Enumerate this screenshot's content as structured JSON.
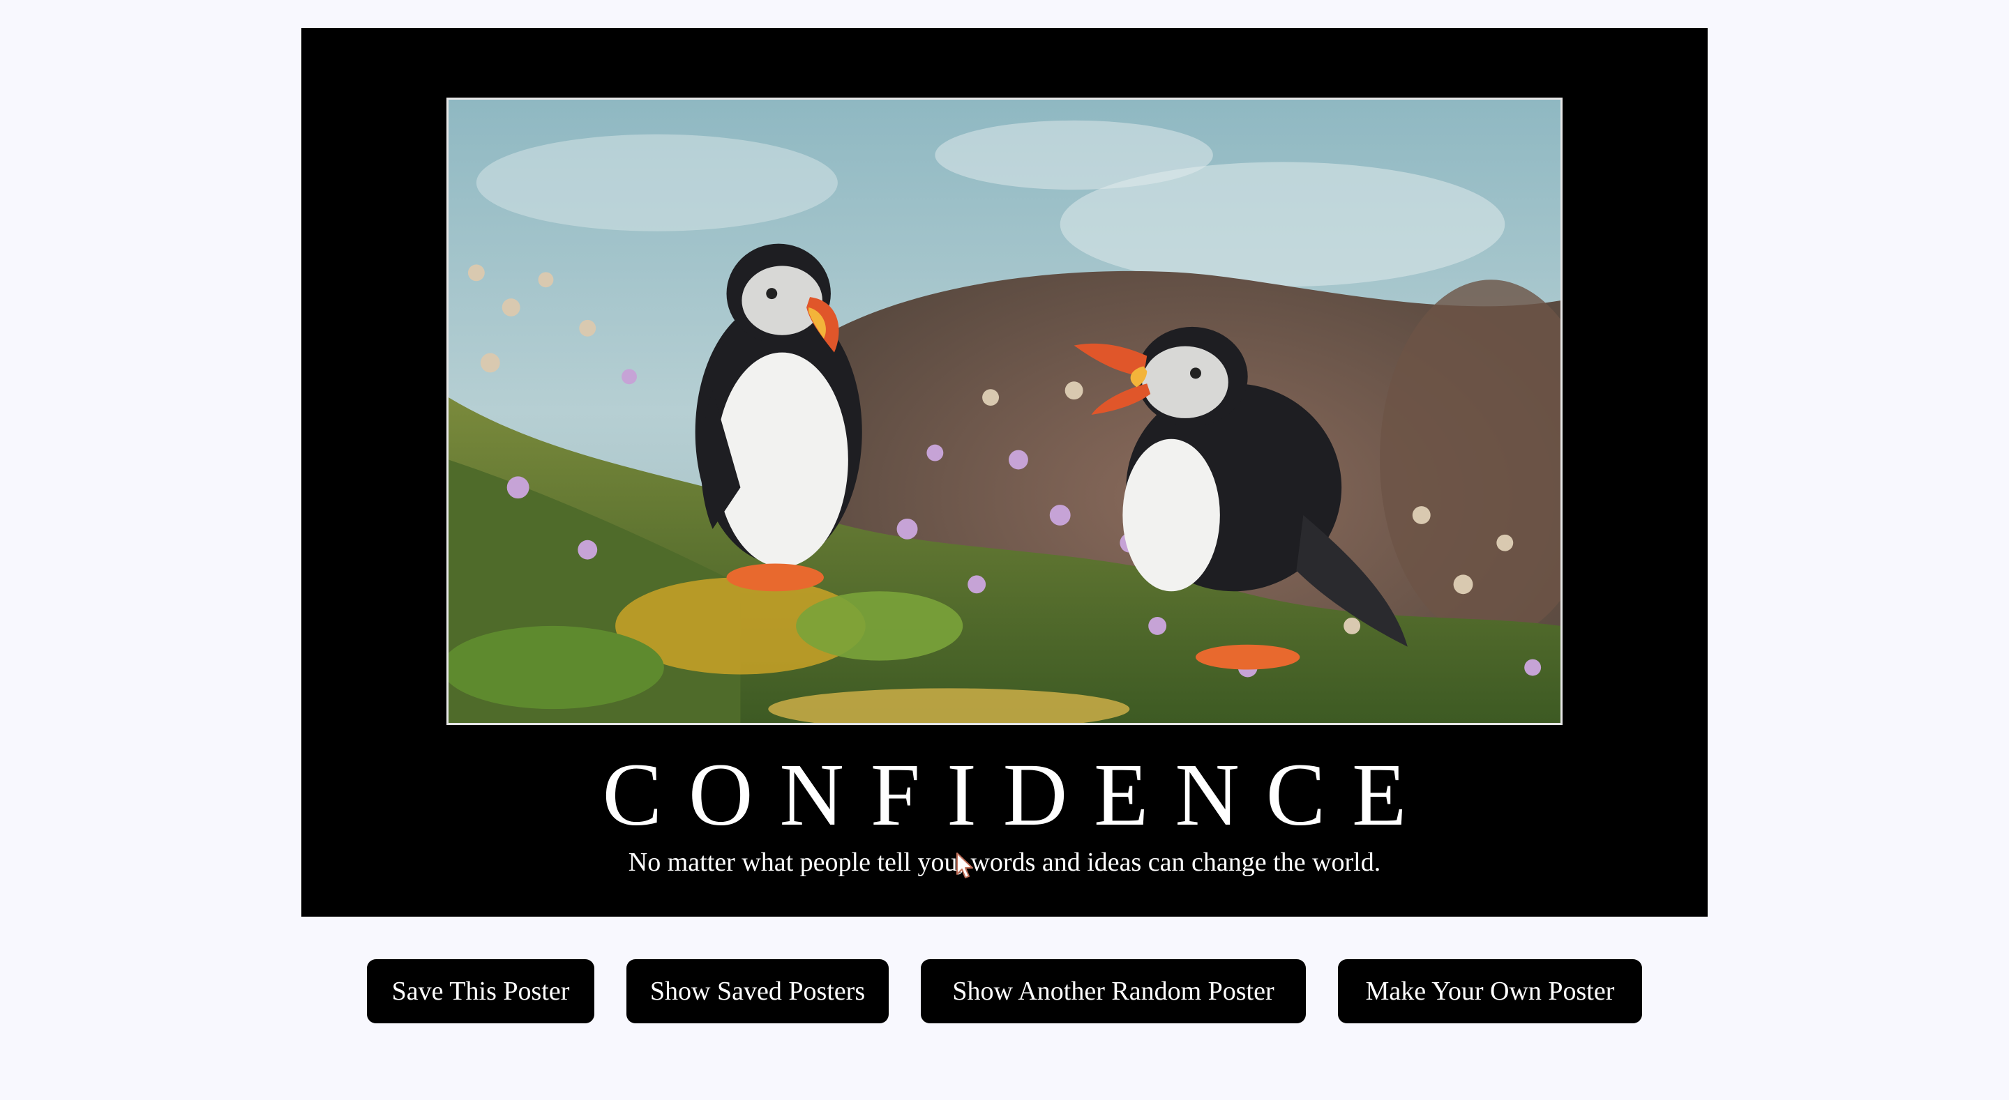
{
  "poster": {
    "title": "CONFIDENCE",
    "quote": "No matter what people tell you, words and ideas can change the world.",
    "image_subject": "two puffins on a flowered cliff"
  },
  "buttons": {
    "save": "Save This Poster",
    "show_saved": "Show Saved Posters",
    "random": "Show Another Random Poster",
    "make_own": "Make Your Own Poster"
  },
  "colors": {
    "page_background": "#f8f8fe",
    "poster_background": "#000000",
    "button_background": "#000000",
    "text": "#ffffff"
  }
}
